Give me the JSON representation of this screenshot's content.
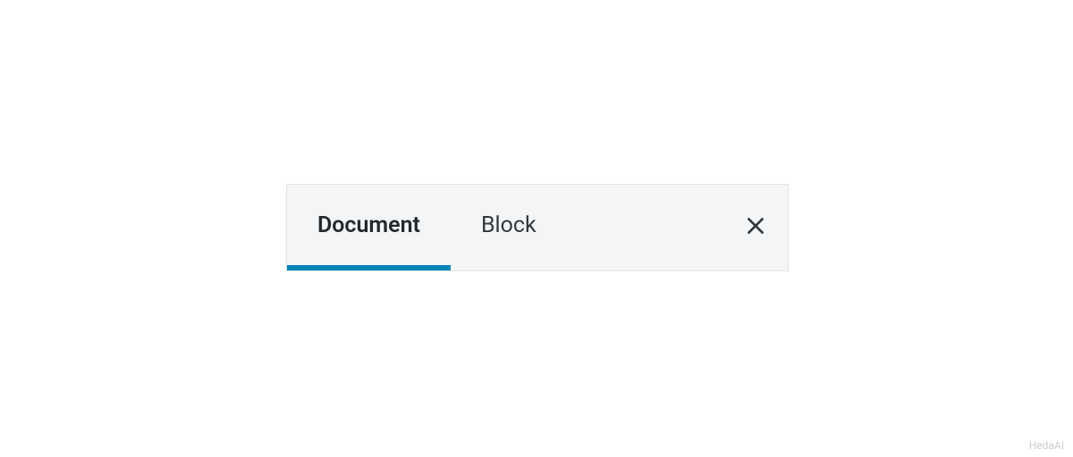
{
  "tabs": {
    "document": {
      "label": "Document"
    },
    "block": {
      "label": "Block"
    }
  },
  "watermark": "HedaAI"
}
